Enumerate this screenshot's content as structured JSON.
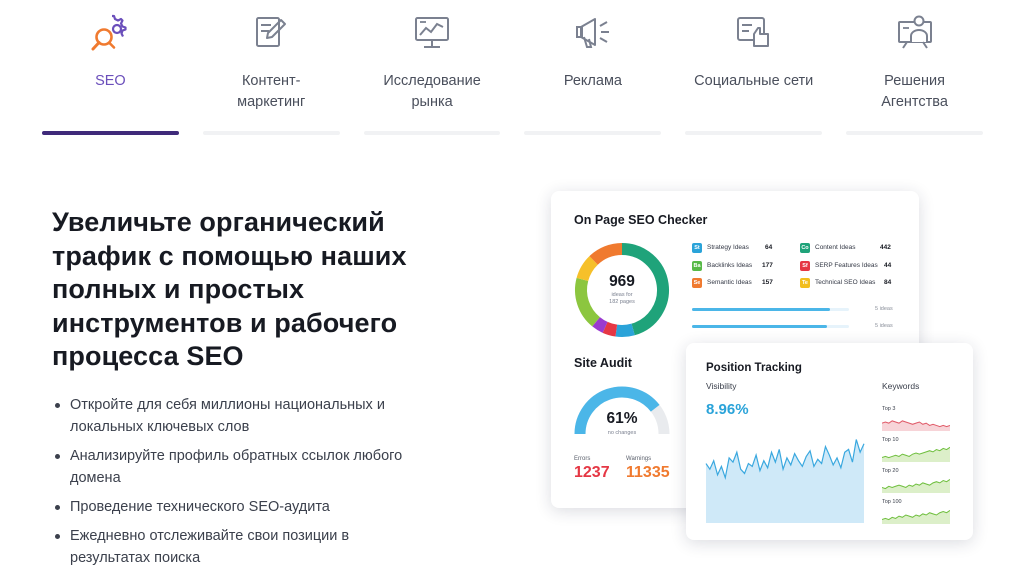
{
  "tabs": [
    {
      "label": "SEO",
      "icon": "seo-search-gear-icon",
      "active": true
    },
    {
      "label": "Контент-маркетинг",
      "icon": "content-edit-icon",
      "active": false
    },
    {
      "label": "Исследование рынка",
      "icon": "market-research-chart-icon",
      "active": false
    },
    {
      "label": "Реклама",
      "icon": "advertising-megaphone-icon",
      "active": false
    },
    {
      "label": "Социальные сети",
      "icon": "social-thumbs-up-icon",
      "active": false
    },
    {
      "label": "Решения Агентства",
      "icon": "agency-presenter-icon",
      "active": false
    }
  ],
  "hero": {
    "headline": "Увеличьте органический трафик с помощью наших полных и простых инструментов и рабочего процесса SEO",
    "bullets": [
      "Откройте для себя миллионы национальных и локальных ключевых слов",
      "Анализируйте профиль обратных ссылок любого домена",
      "Проведение технического SEO-аудита",
      "Ежедневно отслеживайте свои позиции в результатах поиска"
    ]
  },
  "onpage": {
    "title": "On Page SEO Checker",
    "total": "969",
    "total_caption_line1": "ideas for",
    "total_caption_line2": "182 pages",
    "ideas": [
      {
        "code": "St",
        "name": "Strategy Ideas",
        "value": "64",
        "color": "#2aa3d9"
      },
      {
        "code": "Ba",
        "name": "Backlinks Ideas",
        "value": "177",
        "color": "#57b947"
      },
      {
        "code": "Se",
        "name": "Semantic Ideas",
        "value": "157",
        "color": "#f07a2f"
      },
      {
        "code": "Co",
        "name": "Content Ideas",
        "value": "442",
        "color": "#1fa37a"
      },
      {
        "code": "Sf",
        "name": "SERP Features Ideas",
        "value": "44",
        "color": "#e53744"
      },
      {
        "code": "Te",
        "name": "Technical SEO Ideas",
        "value": "84",
        "color": "#f2be1e"
      }
    ],
    "bars": [
      {
        "label": "5 ideas",
        "fraction": 0.88
      },
      {
        "label": "5 ideas",
        "fraction": 0.86
      }
    ],
    "donut": [
      {
        "value": 442,
        "color": "#1fa37a"
      },
      {
        "value": 64,
        "color": "#2aa3d9"
      },
      {
        "value": 44,
        "color": "#e53744"
      },
      {
        "value": 40,
        "color": "#9a3bd0"
      },
      {
        "value": 177,
        "color": "#8cc63f"
      },
      {
        "value": 84,
        "color": "#f6c02a"
      },
      {
        "value": 118,
        "color": "#f07a2f"
      }
    ]
  },
  "audit": {
    "title": "Site Audit",
    "percent": "61%",
    "percent_value": 0.61,
    "caption": "no changes",
    "errors_label": "Errors",
    "errors": "1237",
    "warnings_label": "Warnings",
    "warnings": "11335",
    "errors_color": "#e53744",
    "warnings_color": "#f07a2f"
  },
  "tracking": {
    "title": "Position Tracking",
    "visibility_label": "Visibility",
    "visibility": "8.96%",
    "visibility_color": "#2aa3d9",
    "keywords_label": "Keywords",
    "visibility_series": [
      62,
      58,
      64,
      54,
      60,
      52,
      66,
      63,
      70,
      58,
      55,
      62,
      60,
      68,
      57,
      64,
      59,
      70,
      63,
      72,
      58,
      66,
      61,
      69,
      64,
      60,
      67,
      71,
      60,
      65,
      62,
      74,
      68,
      61,
      66,
      59,
      70,
      72,
      63,
      79,
      70,
      76
    ],
    "keywords": [
      {
        "label": "Top 3",
        "color": "#e05a68",
        "series": [
          6,
          7,
          6,
          8,
          7,
          6,
          8,
          7,
          6,
          5,
          6,
          7,
          5,
          6,
          4,
          5,
          4,
          3,
          4,
          3,
          4
        ]
      },
      {
        "label": "Top 10",
        "color": "#6fbf3e",
        "series": [
          3,
          4,
          3,
          4,
          5,
          4,
          6,
          5,
          4,
          6,
          7,
          6,
          7,
          8,
          9,
          8,
          10,
          9,
          11,
          10,
          12
        ]
      },
      {
        "label": "Top 20",
        "color": "#6fbf3e",
        "series": [
          4,
          3,
          5,
          4,
          5,
          6,
          5,
          4,
          6,
          5,
          7,
          6,
          8,
          7,
          6,
          8,
          9,
          8,
          10,
          9,
          11
        ]
      },
      {
        "label": "Top 100",
        "color": "#6fbf3e",
        "series": [
          3,
          4,
          3,
          5,
          4,
          6,
          5,
          7,
          6,
          5,
          7,
          6,
          8,
          7,
          9,
          8,
          7,
          9,
          10,
          9,
          11
        ]
      }
    ]
  }
}
